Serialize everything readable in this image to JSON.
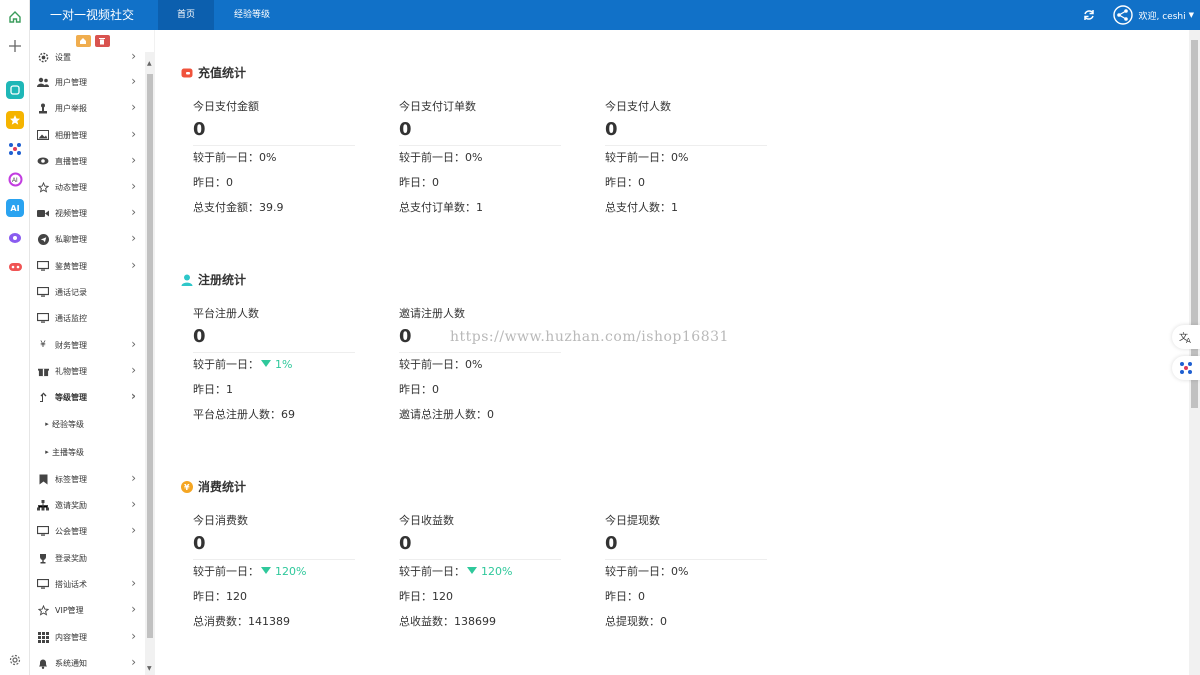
{
  "topbar": {
    "brand": "一对一视频社交",
    "nav": [
      "首页",
      "经验等级"
    ],
    "welcome": "欢迎, ceshi"
  },
  "sidebar": {
    "items": [
      {
        "label": "设置",
        "icon": "gear-icon",
        "arrow": true
      },
      {
        "label": "用户管理",
        "icon": "users-icon",
        "arrow": true
      },
      {
        "label": "用户举报",
        "icon": "report-icon",
        "arrow": true
      },
      {
        "label": "相册管理",
        "icon": "image-icon",
        "arrow": true
      },
      {
        "label": "直播管理",
        "icon": "eye-icon",
        "arrow": true
      },
      {
        "label": "动态管理",
        "icon": "star-icon",
        "arrow": true
      },
      {
        "label": "视频管理",
        "icon": "video-icon",
        "arrow": true
      },
      {
        "label": "私聊管理",
        "icon": "send-icon",
        "arrow": true
      },
      {
        "label": "鉴黄管理",
        "icon": "monitor-icon",
        "arrow": true
      },
      {
        "label": "通话记录",
        "icon": "monitor-icon",
        "arrow": false
      },
      {
        "label": "通话监控",
        "icon": "monitor-icon",
        "arrow": false
      },
      {
        "label": "财务管理",
        "icon": "yen-icon",
        "arrow": true
      },
      {
        "label": "礼物管理",
        "icon": "gift-icon",
        "arrow": true
      },
      {
        "label": "等级管理",
        "icon": "level-icon",
        "arrow": true
      },
      {
        "label": "经验等级",
        "icon": "caret-icon",
        "arrow": false
      },
      {
        "label": "主播等级",
        "icon": "caret-icon",
        "arrow": false
      },
      {
        "label": "标签管理",
        "icon": "bookmark-icon",
        "arrow": true
      },
      {
        "label": "邀请奖励",
        "icon": "sitemap-icon",
        "arrow": true
      },
      {
        "label": "公会管理",
        "icon": "monitor-icon",
        "arrow": true
      },
      {
        "label": "登录奖励",
        "icon": "trophy-icon",
        "arrow": false
      },
      {
        "label": "搭讪话术",
        "icon": "monitor-icon",
        "arrow": true
      },
      {
        "label": "VIP管理",
        "icon": "star-icon",
        "arrow": true
      },
      {
        "label": "内容管理",
        "icon": "grid-icon",
        "arrow": true
      },
      {
        "label": "系统通知",
        "icon": "bell-icon",
        "arrow": true
      }
    ]
  },
  "recharge": {
    "title": "充值统计",
    "stats": [
      {
        "label": "今日支付金额",
        "value": "0",
        "compare": "较于前一日：0%",
        "yesterday": "昨日：0",
        "total": "总支付金额：39.9"
      },
      {
        "label": "今日支付订单数",
        "value": "0",
        "compare": "较于前一日：0%",
        "yesterday": "昨日：0",
        "total": "总支付订单数：1"
      },
      {
        "label": "今日支付人数",
        "value": "0",
        "compare": "较于前一日：0%",
        "yesterday": "昨日：0",
        "total": "总支付人数：1"
      }
    ]
  },
  "register": {
    "title": "注册统计",
    "stats": [
      {
        "label": "平台注册人数",
        "value": "0",
        "compare_prefix": "较于前一日：",
        "compare_pct": "1%",
        "yesterday": "昨日：1",
        "total": "平台总注册人数：69"
      },
      {
        "label": "邀请注册人数",
        "value": "0",
        "compare": "较于前一日：0%",
        "yesterday": "昨日：0",
        "total": "邀请总注册人数：0"
      }
    ]
  },
  "consume": {
    "title": "消费统计",
    "stats": [
      {
        "label": "今日消费数",
        "value": "0",
        "compare_prefix": "较于前一日：",
        "compare_pct": "120%",
        "yesterday": "昨日：120",
        "total": "总消费数：141389"
      },
      {
        "label": "今日收益数",
        "value": "0",
        "compare_prefix": "较于前一日：",
        "compare_pct": "120%",
        "yesterday": "昨日：120",
        "total": "总收益数：138699"
      },
      {
        "label": "今日提现数",
        "value": "0",
        "compare": "较于前一日：0%",
        "yesterday": "昨日：0",
        "total": "总提现数：0"
      }
    ]
  },
  "watermark": "https://www.huzhan.com/ishop16831",
  "colors": {
    "topbar": "#1171c8",
    "accent_green": "#2fc89b"
  }
}
